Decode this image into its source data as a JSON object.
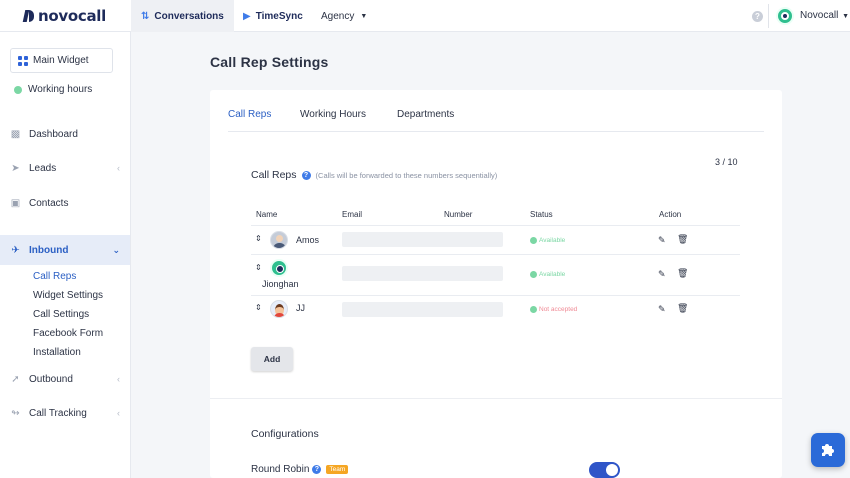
{
  "brand": {
    "logo_text": "novocall"
  },
  "topnav": {
    "tabs": [
      {
        "label": "Conversations",
        "icon": "conversations-icon"
      },
      {
        "label": "TimeSync",
        "icon": "timesync-icon"
      },
      {
        "label": "Agency",
        "icon": "chevron-down-icon"
      }
    ],
    "user_name": "Novocall",
    "help_icon": "help-icon"
  },
  "sidebar": {
    "widget_label": "Main Widget",
    "hours_label": "Working hours",
    "items": [
      {
        "label": "Dashboard",
        "icon": "chart-icon"
      },
      {
        "label": "Leads",
        "icon": "send-icon"
      },
      {
        "label": "Contacts",
        "icon": "contact-card-icon"
      },
      {
        "label": "Inbound",
        "icon": "plane-icon"
      },
      {
        "label": "Outbound",
        "icon": "rocket-icon"
      },
      {
        "label": "Call Tracking",
        "icon": "tracking-icon"
      }
    ],
    "sub_items": [
      "Call Reps",
      "Widget Settings",
      "Call Settings",
      "Facebook Form",
      "Installation"
    ]
  },
  "main": {
    "title": "Call Rep Settings",
    "tabs": [
      "Call Reps",
      "Working Hours",
      "Departments"
    ],
    "counter": "3 / 10",
    "section_title": "Call Reps",
    "section_hint": "(Calls will be forwarded to these numbers sequentially)",
    "columns": [
      "Name",
      "Email",
      "Number",
      "Status",
      "Action"
    ],
    "rows": [
      {
        "name": "Amos",
        "status": "Available"
      },
      {
        "name": "Jionghan",
        "status": "Available"
      },
      {
        "name": "JJ",
        "status": "Not accepted"
      }
    ],
    "add_label": "Add",
    "config_title": "Configurations",
    "round_robin_label": "Round Robin",
    "round_robin_badge": "Team",
    "round_robin_enabled": true
  },
  "colors": {
    "accent": "#2b5fc4",
    "available": "#7bd7a4",
    "not_accepted": "#f08a95",
    "badge": "#f5a623",
    "toggle": "#2f55c8"
  }
}
